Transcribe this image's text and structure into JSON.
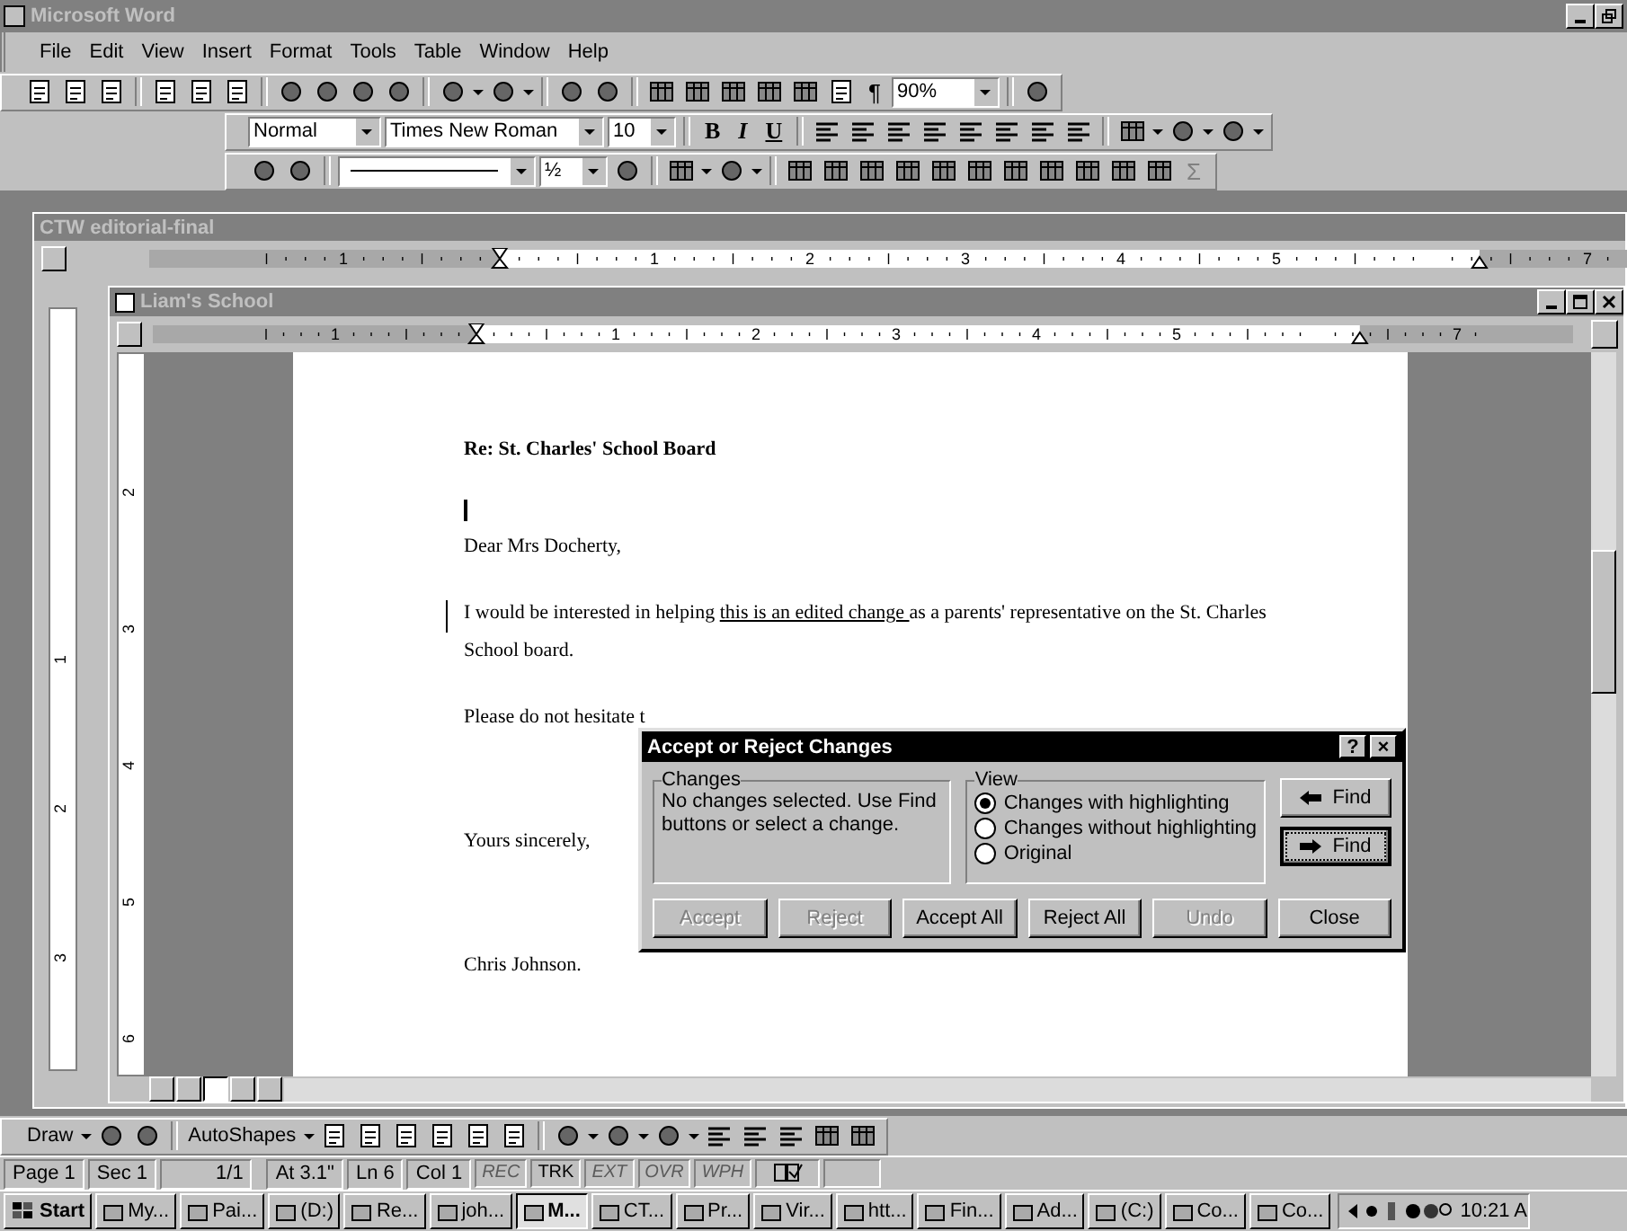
{
  "app": {
    "title": "Microsoft Word"
  },
  "menu": [
    "File",
    "Edit",
    "View",
    "Insert",
    "Format",
    "Tools",
    "Table",
    "Window",
    "Help"
  ],
  "standard_toolbar": {
    "show_hide": "¶",
    "zoom": "90%"
  },
  "formatting_toolbar": {
    "style": "Normal",
    "font": "Times New Roman",
    "size": "10",
    "bold": "B",
    "italic": "I",
    "underline": "U"
  },
  "tables_toolbar": {
    "weight": "½",
    "autosum": "Σ"
  },
  "outer_window": {
    "title": "CTW editorial-final",
    "ruler": [
      "1",
      "1",
      "2",
      "3",
      "4",
      "5",
      "7"
    ],
    "vruler": [
      "1",
      "2",
      "3"
    ]
  },
  "inner_window": {
    "title": "Liam's School",
    "ruler": [
      "1",
      "1",
      "2",
      "3",
      "4",
      "5",
      "7"
    ],
    "vruler": [
      "2",
      "3",
      "4",
      "5",
      "6"
    ]
  },
  "document": [
    {
      "kind": "heading",
      "text": "Re: St. Charles' School Board"
    },
    {
      "kind": "caret"
    },
    {
      "kind": "para",
      "text": "Dear Mrs Docherty,"
    },
    {
      "kind": "para",
      "changed": true,
      "parts": [
        {
          "text": "I would be interested in helping ",
          "inserted": false
        },
        {
          "text": "this is an edited change ",
          "inserted": true
        },
        {
          "text": "as a parents' representative on the St. Charles School board.",
          "inserted": false
        }
      ]
    },
    {
      "kind": "para",
      "text": "Please do not hesitate t"
    },
    {
      "kind": "gap"
    },
    {
      "kind": "para",
      "text": "Yours sincerely,"
    },
    {
      "kind": "gap"
    },
    {
      "kind": "para",
      "text": "Chris Johnson."
    }
  ],
  "dialog": {
    "title": "Accept or Reject Changes",
    "help": "?",
    "close": "×",
    "changes_label": "Changes",
    "changes_text": "No changes selected. Use Find buttons or select a change.",
    "view_label": "View",
    "options": [
      {
        "label": "Changes with highlighting",
        "selected": true
      },
      {
        "label": "Changes without highlighting",
        "selected": false
      },
      {
        "label": "Original",
        "selected": false
      }
    ],
    "find": [
      "Find",
      "Find"
    ],
    "buttons": [
      {
        "label": "Accept",
        "disabled": true
      },
      {
        "label": "Reject",
        "disabled": true
      },
      {
        "label": "Accept All",
        "disabled": false
      },
      {
        "label": "Reject All",
        "disabled": false
      },
      {
        "label": "Undo",
        "disabled": true
      },
      {
        "label": "Close",
        "disabled": false
      }
    ]
  },
  "drawing_toolbar": {
    "draw": "Draw",
    "autoshapes": "AutoShapes"
  },
  "status_bar": {
    "fields": [
      "Page 1",
      "Sec 1",
      "1/1",
      "At 3.1\"",
      "Ln 6",
      "Col 1"
    ],
    "indicators": [
      {
        "label": "REC",
        "on": false
      },
      {
        "label": "TRK",
        "on": true
      },
      {
        "label": "EXT",
        "on": false
      },
      {
        "label": "OVR",
        "on": false
      },
      {
        "label": "WPH",
        "on": false
      }
    ]
  },
  "taskbar": {
    "start": "Start",
    "items": [
      {
        "label": "My...",
        "selected": false
      },
      {
        "label": "Pai...",
        "selected": false
      },
      {
        "label": "(D:)",
        "selected": false
      },
      {
        "label": "Re...",
        "selected": false
      },
      {
        "label": "joh...",
        "selected": false
      },
      {
        "label": "M...",
        "selected": true
      },
      {
        "label": "CT...",
        "selected": false
      },
      {
        "label": "Pr...",
        "selected": false
      },
      {
        "label": "Vir...",
        "selected": false
      },
      {
        "label": "htt...",
        "selected": false
      },
      {
        "label": "Fin...",
        "selected": false
      },
      {
        "label": "Ad...",
        "selected": false
      },
      {
        "label": "(C:)",
        "selected": false
      },
      {
        "label": "Co...",
        "selected": false
      },
      {
        "label": "Co...",
        "selected": false
      }
    ],
    "time": "10:21 A"
  }
}
